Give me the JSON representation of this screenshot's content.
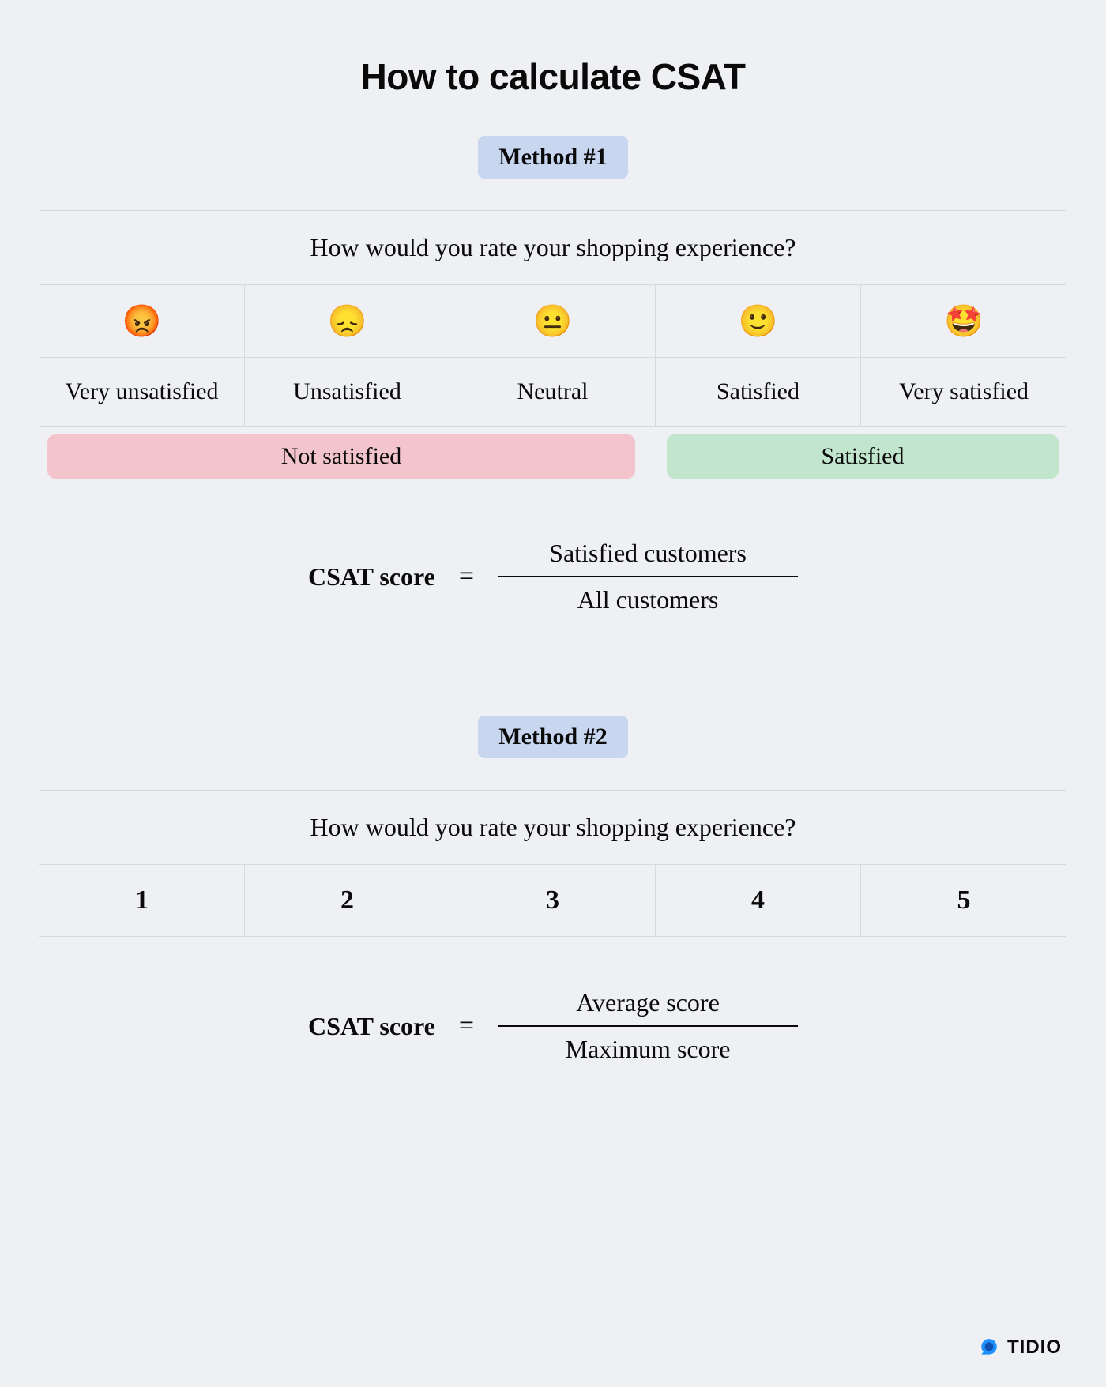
{
  "title": "How to calculate CSAT",
  "method1": {
    "badge": "Method #1",
    "question": "How would you rate your shopping experience?",
    "emojis": [
      "😡",
      "😞",
      "😐",
      "🙂",
      "🤩"
    ],
    "labels": [
      "Very unsatisfied",
      "Unsatisfied",
      "Neutral",
      "Satisfied",
      "Very satisfied"
    ],
    "group_not_satisfied": "Not satisfied",
    "group_satisfied": "Satisfied",
    "formula_label": "CSAT score",
    "numerator": "Satisfied customers",
    "denominator": "All customers"
  },
  "method2": {
    "badge": "Method #2",
    "question": "How would you rate your shopping experience?",
    "numbers": [
      "1",
      "2",
      "3",
      "4",
      "5"
    ],
    "formula_label": "CSAT score",
    "numerator": "Average score",
    "denominator": "Maximum score"
  },
  "brand": "TIDIO"
}
